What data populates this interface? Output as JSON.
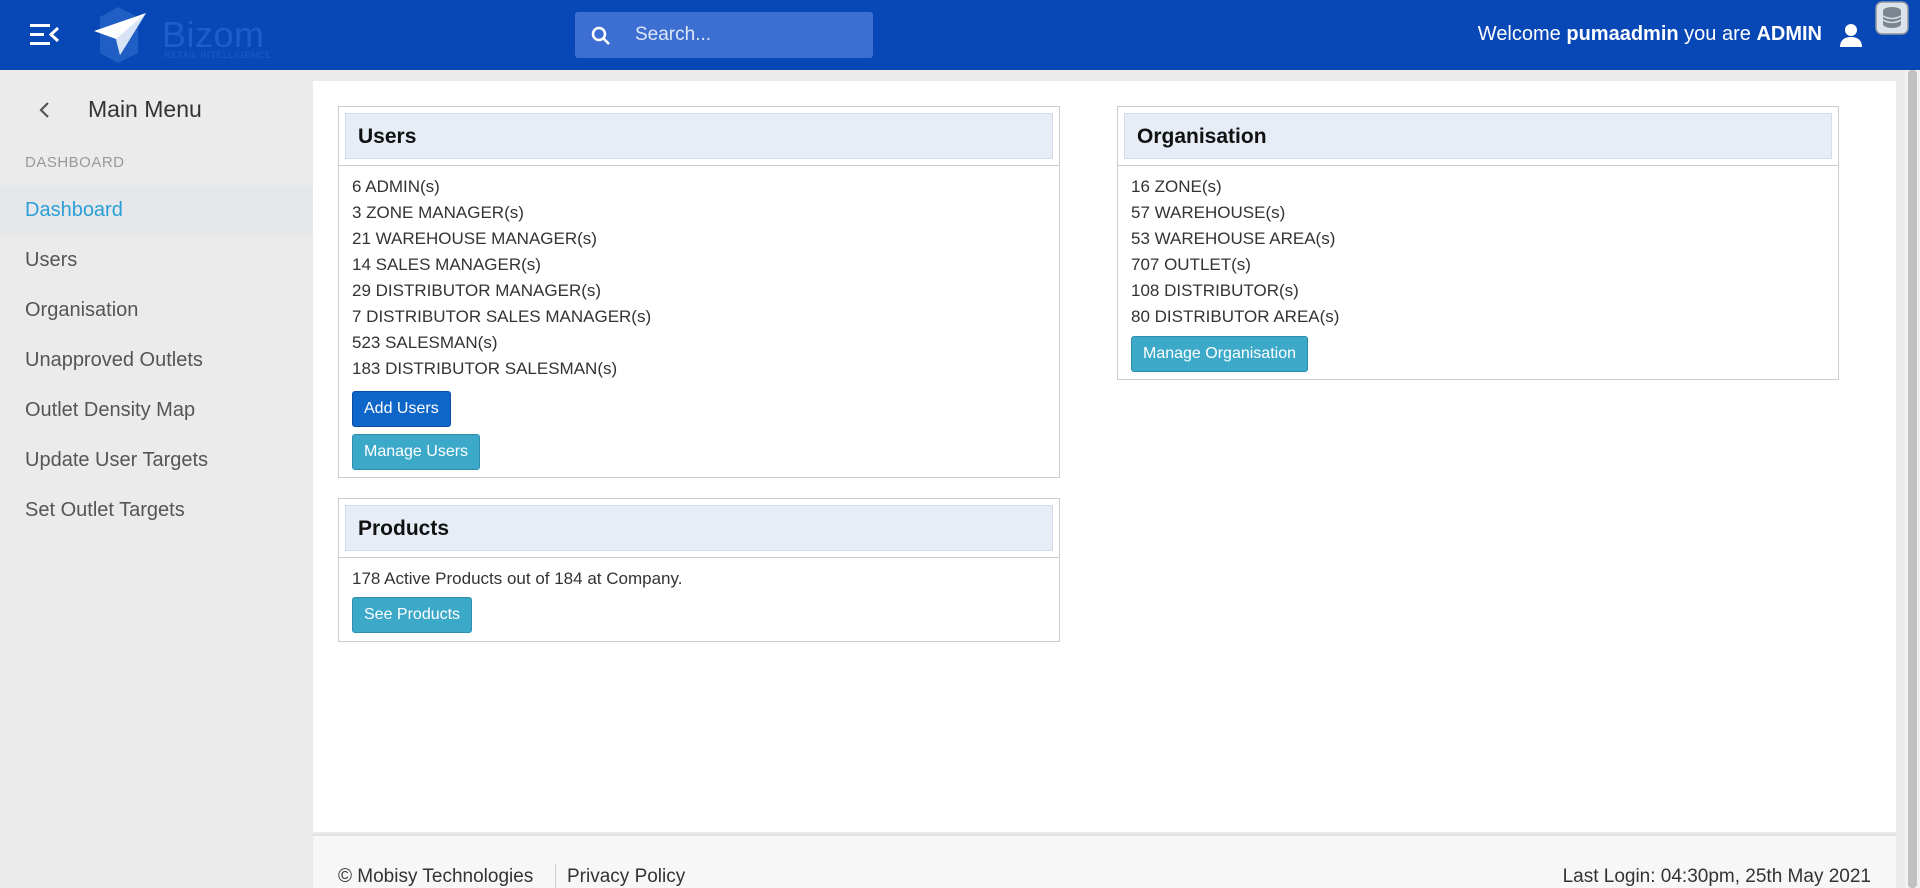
{
  "header": {
    "brand": "Bizom",
    "brand_tagline": "RETAIL INTELLIGENCE",
    "search_placeholder": "Search...",
    "welcome_prefix": "Welcome",
    "username": "pumaadmin",
    "role_prefix": "you are",
    "role": "ADMIN",
    "colors": {
      "bar": "#0747b6",
      "search": "#3d6fd2"
    }
  },
  "sidebar": {
    "title": "Main Menu",
    "section": "DASHBOARD",
    "items": [
      {
        "label": "Dashboard",
        "active": true
      },
      {
        "label": "Users"
      },
      {
        "label": "Organisation"
      },
      {
        "label": "Unapproved Outlets"
      },
      {
        "label": "Outlet Density Map"
      },
      {
        "label": "Update User Targets"
      },
      {
        "label": "Set Outlet Targets"
      }
    ],
    "active_color": "#2a9fd6"
  },
  "users_card": {
    "title": "Users",
    "lines": [
      "6 ADMIN(s)",
      "3 ZONE MANAGER(s)",
      "21 WAREHOUSE MANAGER(s)",
      "14 SALES MANAGER(s)",
      "29 DISTRIBUTOR MANAGER(s)",
      "7 DISTRIBUTOR SALES MANAGER(s)",
      "523 SALESMAN(s)",
      "183 DISTRIBUTOR SALESMAN(s)"
    ],
    "add_button": "Add Users",
    "manage_button": "Manage Users"
  },
  "products_card": {
    "title": "Products",
    "summary": "178 Active Products out of 184 at Company.",
    "button": "See Products"
  },
  "org_card": {
    "title": "Organisation",
    "lines": [
      "16 ZONE(s)",
      "57 WAREHOUSE(s)",
      "53 WAREHOUSE AREA(s)",
      "707 OUTLET(s)",
      "108 DISTRIBUTOR(s)",
      "80 DISTRIBUTOR AREA(s)"
    ],
    "button": "Manage Organisation"
  },
  "footer": {
    "copyright": "© Mobisy Technologies",
    "privacy": "Privacy Policy",
    "last_login": "Last Login: 04:30pm, 25th May 2021"
  },
  "icons": {
    "menu": "hamburger-collapse-icon",
    "search": "search-icon",
    "user": "user-icon",
    "back": "chevron-left-icon",
    "extension": "database-extension-icon"
  }
}
